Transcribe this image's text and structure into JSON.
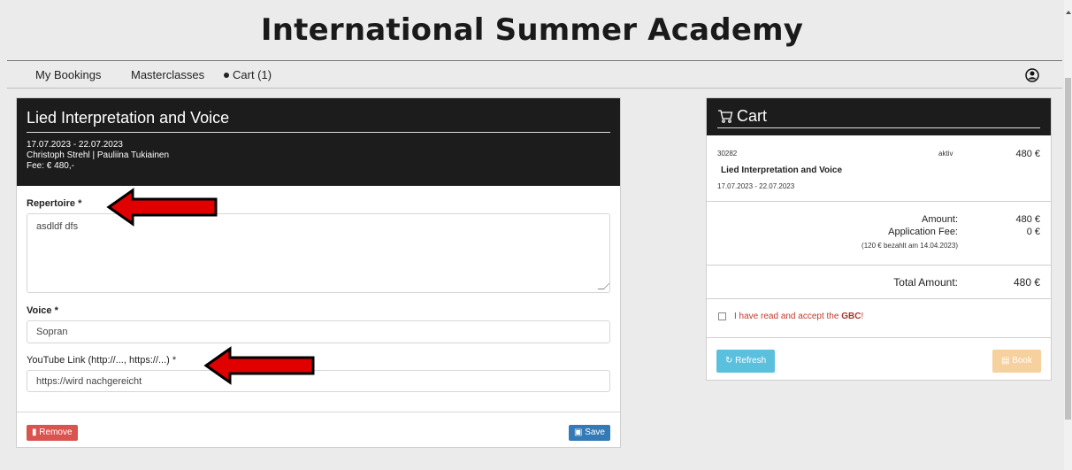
{
  "app": {
    "title": "International Summer Academy"
  },
  "nav": {
    "my_bookings": "My Bookings",
    "masterclasses": "Masterclasses",
    "cart": "Cart (1)"
  },
  "course": {
    "title": "Lied Interpretation and Voice",
    "dates": "17.07.2023 - 22.07.2023",
    "teachers": "Christoph Strehl | Pauliina Tukiainen",
    "fee": "Fee: € 480,-"
  },
  "form": {
    "repertoire_label": "Repertoire *",
    "repertoire_value": "asdldf dfs",
    "voice_label": "Voice *",
    "voice_value": "Sopran",
    "youtube_label": "YouTube Link (http://..., https://...) *",
    "youtube_value": "https://wird nachgereicht",
    "remove_label": "Remove",
    "save_label": "Save"
  },
  "cart": {
    "title": "Cart",
    "item": {
      "id": "30282",
      "status": "aktiv",
      "price": "480 €",
      "name": "Lied Interpretation and Voice",
      "dates": "17.07.2023 - 22.07.2023"
    },
    "amount_label": "Amount:",
    "amount_value": "480 €",
    "app_fee_label": "Application Fee:",
    "app_fee_value": "0 €",
    "app_fee_note": "(120 € bezahlt am 14.04.2023)",
    "total_label": "Total Amount:",
    "total_value": "480 €",
    "gbc_prefix": "I have read and accept the ",
    "gbc_link": "GBC",
    "gbc_suffix": "!",
    "refresh_label": "Refresh",
    "book_label": "Book"
  },
  "colors": {
    "header_dark": "#1c1c1c",
    "remove": "#d9534f",
    "save": "#337ab7",
    "refresh": "#5bc0de",
    "book": "#f0ad4e",
    "arrow": "#e00000"
  }
}
